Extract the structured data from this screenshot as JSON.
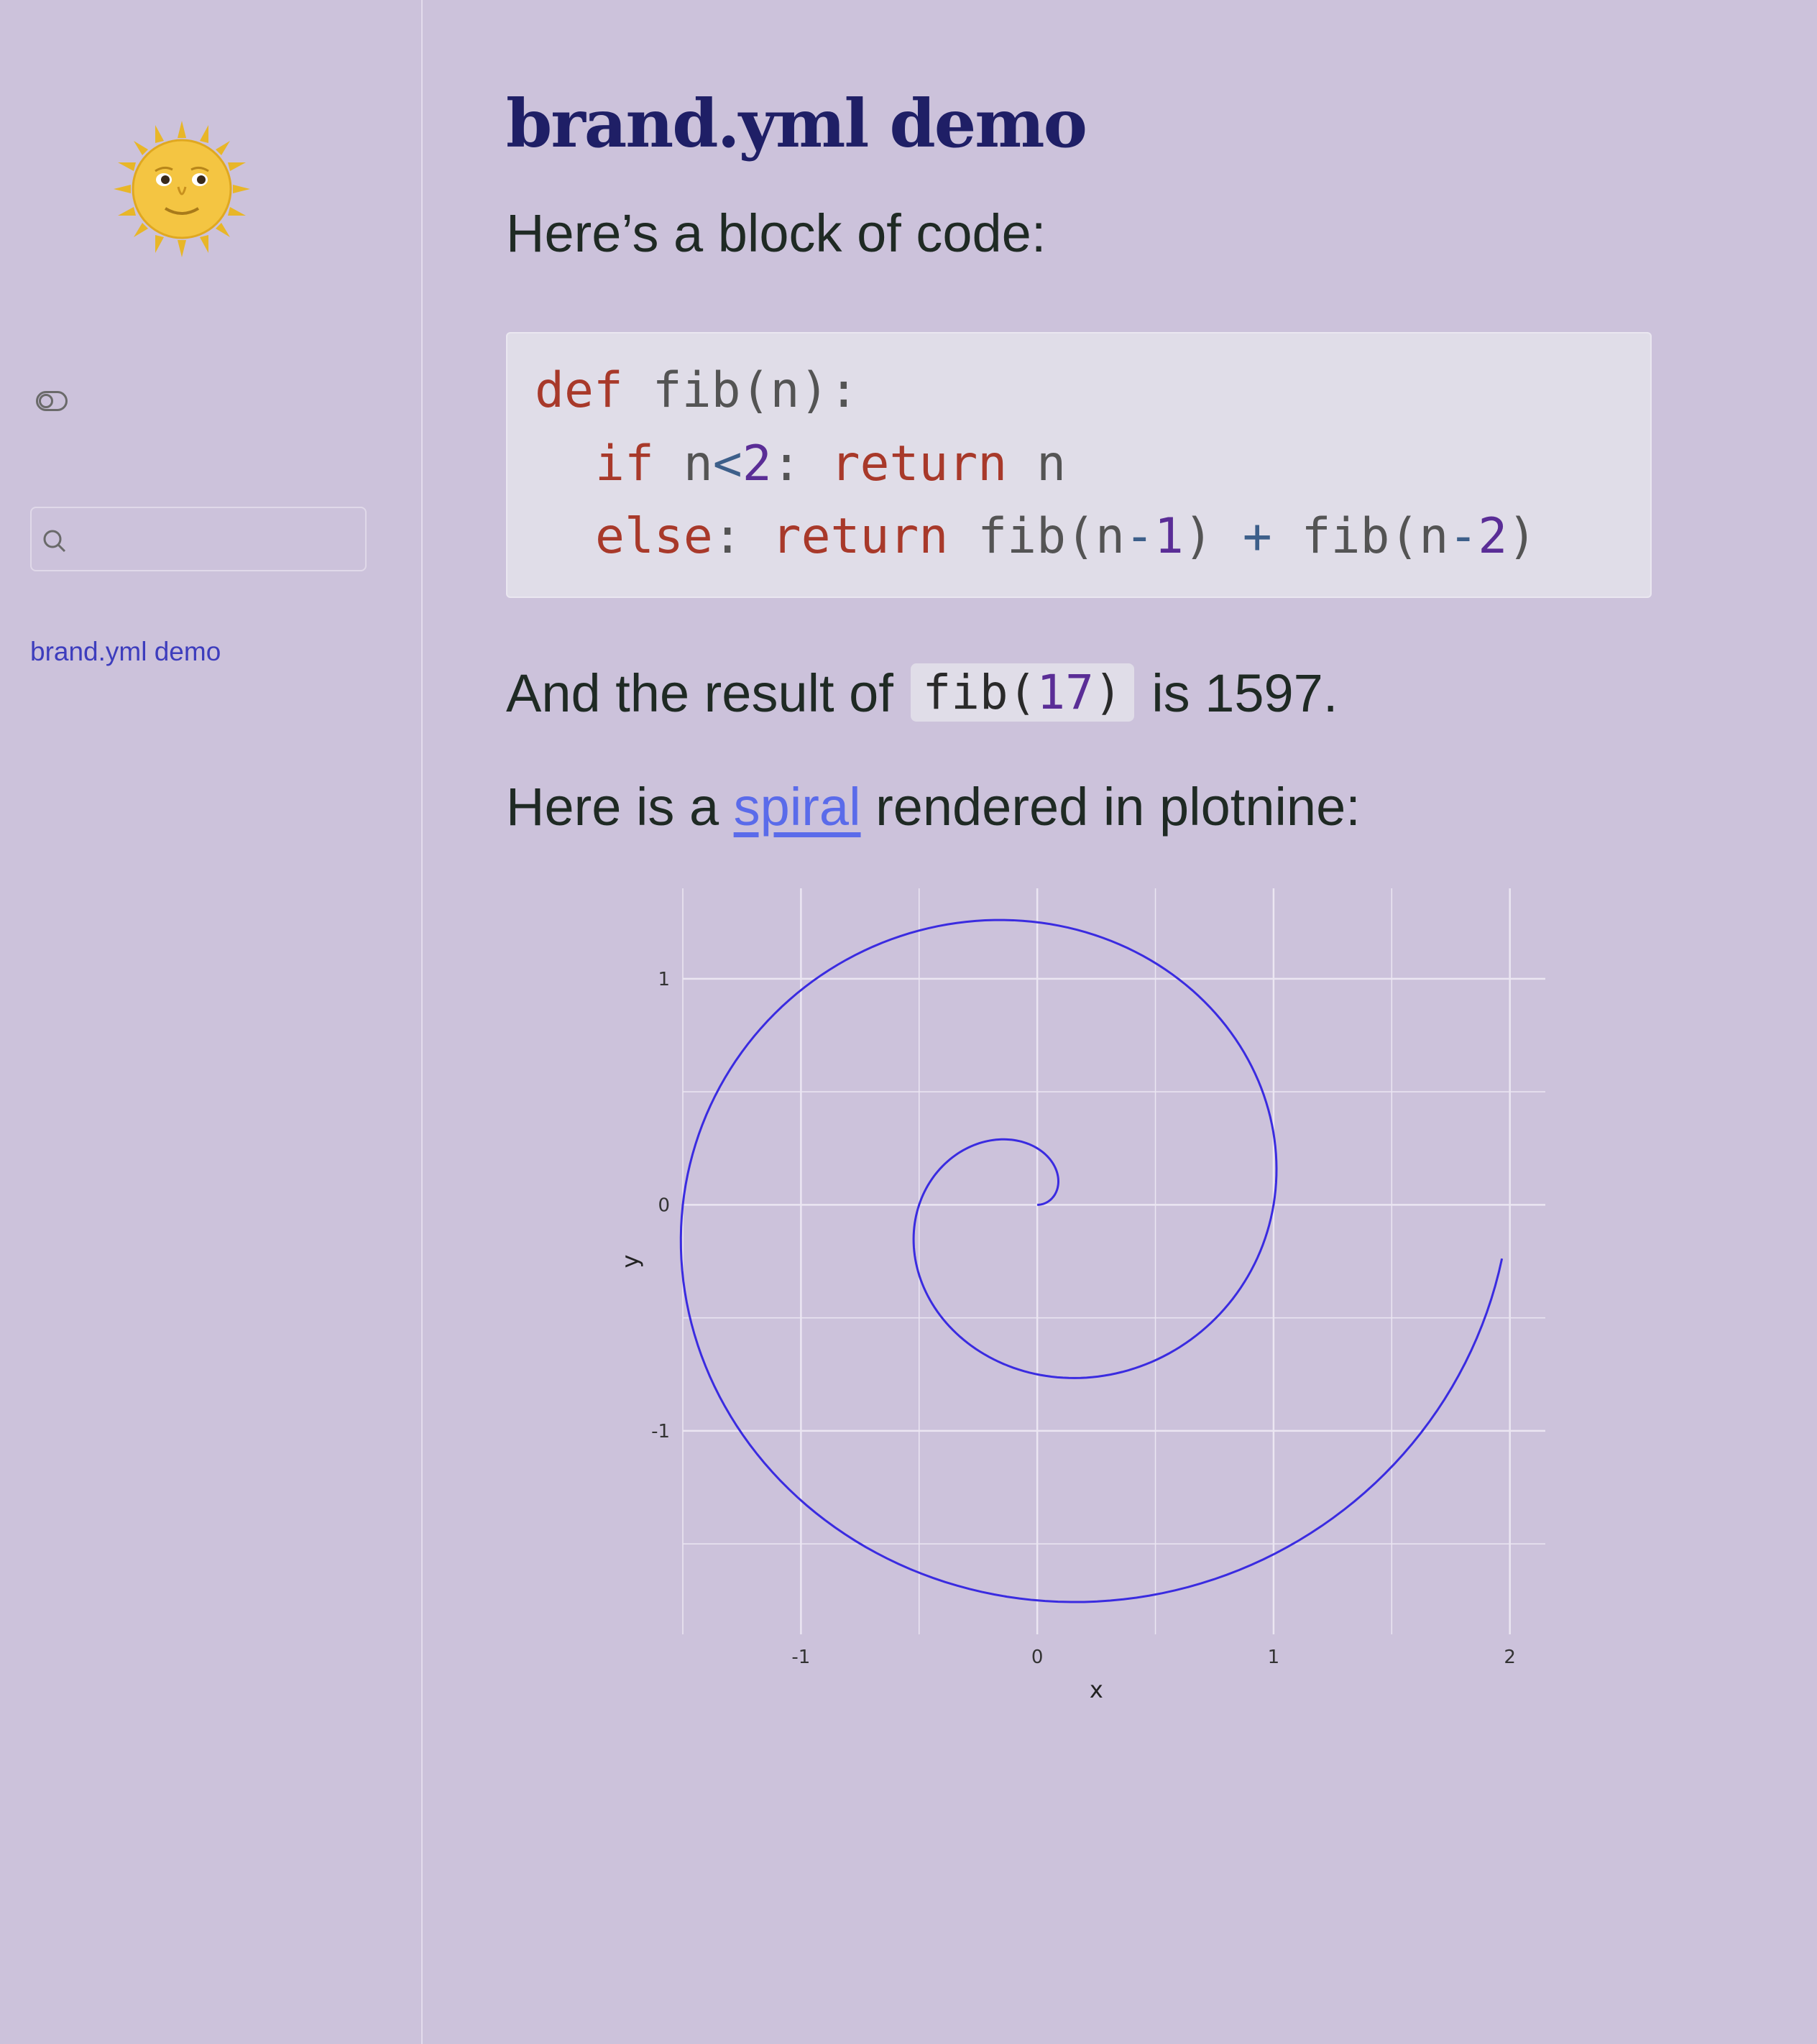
{
  "sidebar": {
    "logo_icon": "sun-with-face-icon",
    "toggle_icon": "toggle-icon",
    "search": {
      "placeholder": "",
      "icon": "search-icon"
    },
    "nav_items": [
      {
        "label": "brand.yml demo"
      }
    ]
  },
  "main": {
    "title": "brand.yml demo",
    "intro": "Here’s a block of code:",
    "code": {
      "l1_def": "def",
      "l1_rest": " fib(n):",
      "l2_if": "if",
      "l2_n": " n",
      "l2_lt": "<",
      "l2_2": "2",
      "l2_colon": ": ",
      "l2_return": "return",
      "l2_n2": " n",
      "l3_else": "else",
      "l3_colon": ": ",
      "l3_return": "return",
      "l3_fib1": " fib(n",
      "l3_minus1": "-",
      "l3_1": "1",
      "l3_close1": ") ",
      "l3_plus": "+",
      "l3_fib2": " fib(n",
      "l3_minus2": "-",
      "l3_2": "2",
      "l3_close2": ")"
    },
    "result": {
      "before": "And the result of ",
      "code_fn": "fib(",
      "code_num": "17",
      "code_close": ")",
      "after": " is 1597."
    },
    "spiral_sentence": {
      "before": "Here is a ",
      "link": "spiral",
      "after": " rendered in plotnine:"
    }
  },
  "colors": {
    "background": "#ccc2db",
    "title": "#1f1f66",
    "link": "#5a6bea",
    "nav_link": "#3d3dbd",
    "spiral_line": "#3a2be0",
    "keyword": "#a8392a",
    "number": "#5a2d96"
  },
  "chart_data": {
    "type": "line",
    "description_curve": "parametric spiral x = t*cos(t)/(2*pi), y = t*sin(t)/(2*pi), t from 0 to 4*pi - 0.12",
    "xlabel": "x",
    "ylabel": "y",
    "xlim": [
      -1.5,
      2.15
    ],
    "ylim": [
      -1.9,
      1.4
    ],
    "x_ticks": [
      "-1",
      "0",
      "1",
      "2"
    ],
    "y_ticks": [
      "1",
      "0",
      "-1"
    ],
    "x_tick_values": [
      -1,
      0,
      1,
      2
    ],
    "y_tick_values": [
      1,
      0,
      -1
    ],
    "grid": true,
    "legend": "none",
    "series": [
      {
        "points_t_param": {
          "t_start": 0,
          "t_end": 12.446,
          "steps": 400
        }
      }
    ]
  }
}
